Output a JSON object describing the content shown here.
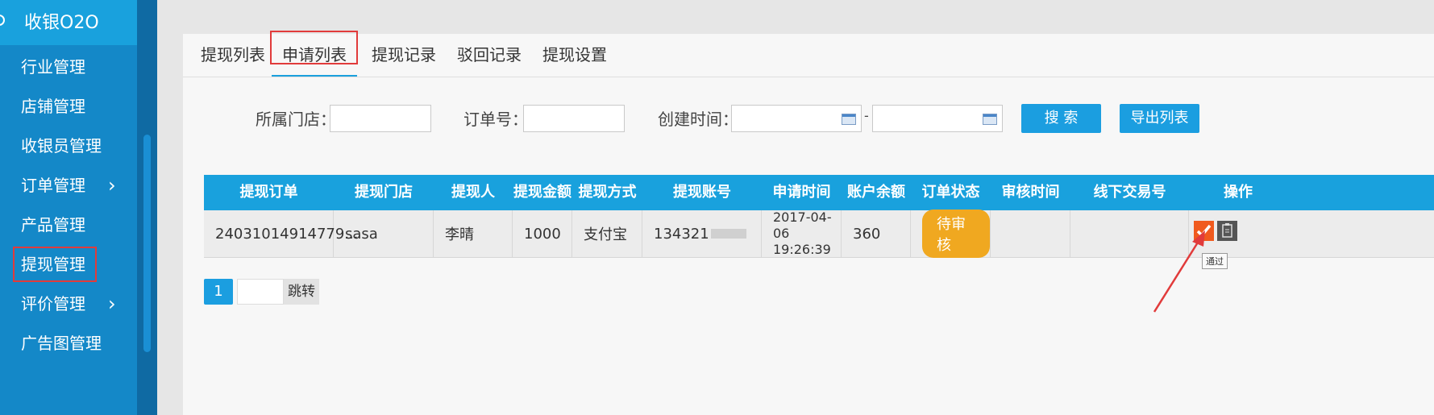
{
  "sidebar": {
    "title": "收银O2O",
    "items": [
      {
        "label": "行业管理",
        "chevron": false
      },
      {
        "label": "店铺管理",
        "chevron": false
      },
      {
        "label": "收银员管理",
        "chevron": false
      },
      {
        "label": "订单管理",
        "chevron": true
      },
      {
        "label": "产品管理",
        "chevron": false
      },
      {
        "label": "提现管理",
        "chevron": false
      },
      {
        "label": "评价管理",
        "chevron": true
      },
      {
        "label": "广告图管理",
        "chevron": false
      }
    ],
    "chevron_glyph": "›"
  },
  "tabs": [
    "提现列表",
    "申请列表",
    "提现记录",
    "驳回记录",
    "提现设置"
  ],
  "filters": {
    "store_label": "所属门店：",
    "store_value": "",
    "order_label": "订单号：",
    "order_value": "",
    "created_label": "创建时间：",
    "date_separator": "-",
    "search_button": "搜 索",
    "export_button": "导出列表"
  },
  "table": {
    "headers": [
      "提现订单",
      "提现门店",
      "提现人",
      "提现金额",
      "提现方式",
      "提现账号",
      "申请时间",
      "账户余额",
      "订单状态",
      "审核时间",
      "线下交易号",
      "操作"
    ],
    "rows": [
      {
        "order": "24031014914779...",
        "store": "sasa",
        "person": "李晴",
        "amount": "1000",
        "method": "支付宝",
        "account": "134321",
        "apply_time": [
          "2017-04-",
          "06",
          "19:26:39"
        ],
        "balance": "360",
        "status": "待审核",
        "review_time": "",
        "offline_no": ""
      }
    ],
    "approve_tooltip": "通过"
  },
  "pagination": {
    "current": "1",
    "jump_label": "跳转"
  },
  "colors": {
    "accent": "#1b9ee0",
    "sidebar": "#1488c8",
    "status_badge": "#f0a820",
    "approve": "#f05a1e",
    "highlight": "#e13b3b"
  }
}
